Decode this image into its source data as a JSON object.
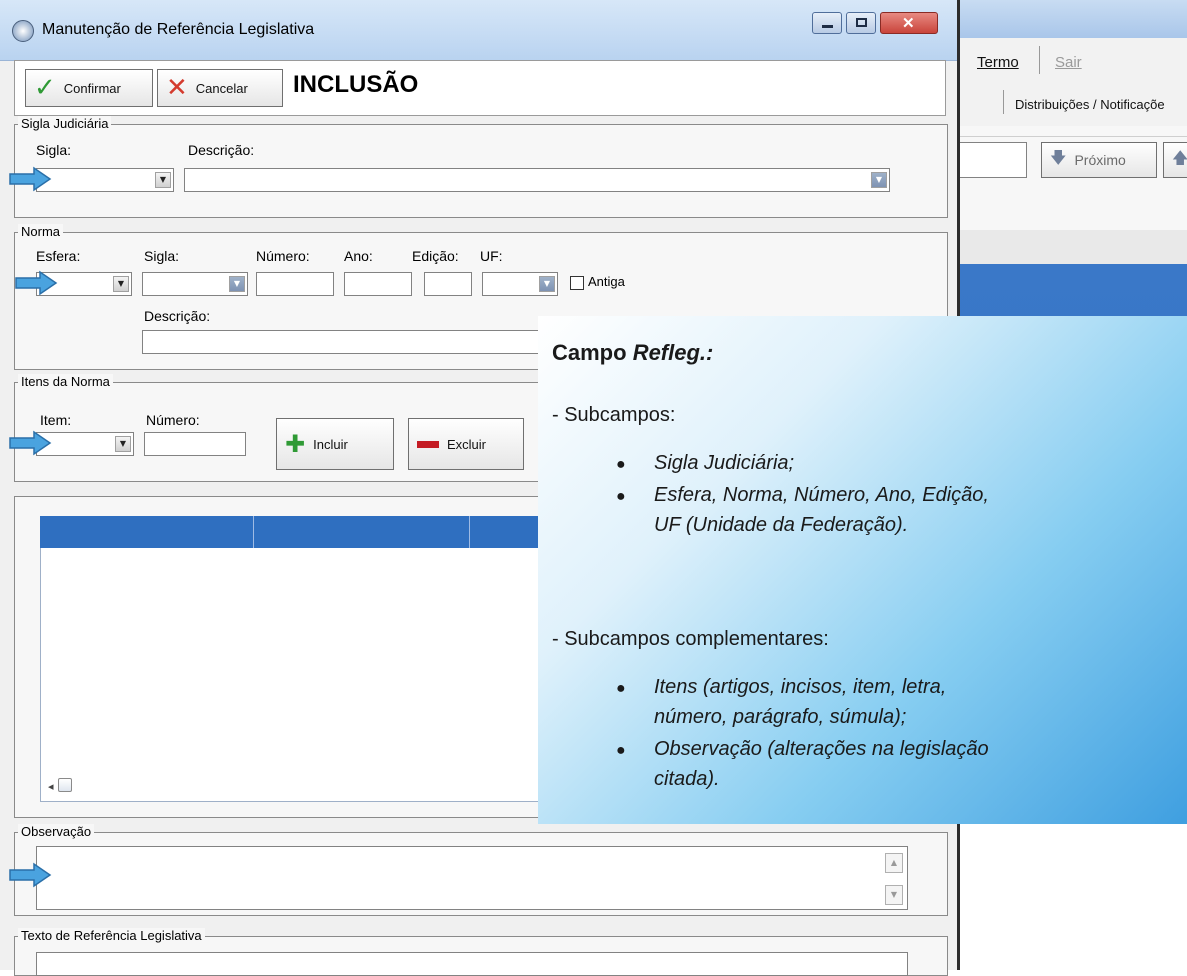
{
  "window": {
    "title": "Manutenção de Referência Legislativa"
  },
  "toolbar": {
    "confirm_label": "Confirmar",
    "cancel_label": "Cancelar",
    "mode": "INCLUSÃO"
  },
  "sigla_judiciaria": {
    "legend": "Sigla Judiciária",
    "sigla_label": "Sigla:",
    "descricao_label": "Descrição:"
  },
  "norma": {
    "legend": "Norma",
    "esfera_label": "Esfera:",
    "sigla_label": "Sigla:",
    "numero_label": "Número:",
    "ano_label": "Ano:",
    "edicao_label": "Edição:",
    "uf_label": "UF:",
    "antiga_label": "Antiga",
    "descricao_label": "Descrição:"
  },
  "itens_norma": {
    "legend": "Itens da Norma",
    "item_label": "Item:",
    "numero_label": "Número:",
    "incluir_label": "Incluir",
    "excluir_label": "Excluir"
  },
  "observacao": {
    "legend": "Observação"
  },
  "texto_ref": {
    "legend": "Texto de Referência Legislativa"
  },
  "background_window": {
    "menu_termo": "Termo",
    "menu_sair": "Sair",
    "tab_distrib": "Distribuições / Notificaçõe",
    "proximo_label": "Próximo"
  },
  "callout": {
    "title_plain": "Campo ",
    "title_italic": "Refleg.:",
    "subcampos": "- Subcampos:",
    "bullet1": "Sigla Judiciária;",
    "bullet2a": "Esfera, Norma, Número, Ano, Edição,",
    "bullet2b": "UF (Unidade da Federação).",
    "subcampos_compl": "- Subcampos complementares:",
    "bullet3a": "Itens (artigos, incisos, item, letra,",
    "bullet3b": "número, parágrafo, súmula);",
    "bullet4a": "Observação (alterações na legislação",
    "bullet4b": "citada)."
  },
  "colors": {
    "title_gradient_top": "#d7e7f8",
    "grid_header": "#2f6fc0",
    "close_button": "#c9443b",
    "arrow": "#4aa3df"
  }
}
